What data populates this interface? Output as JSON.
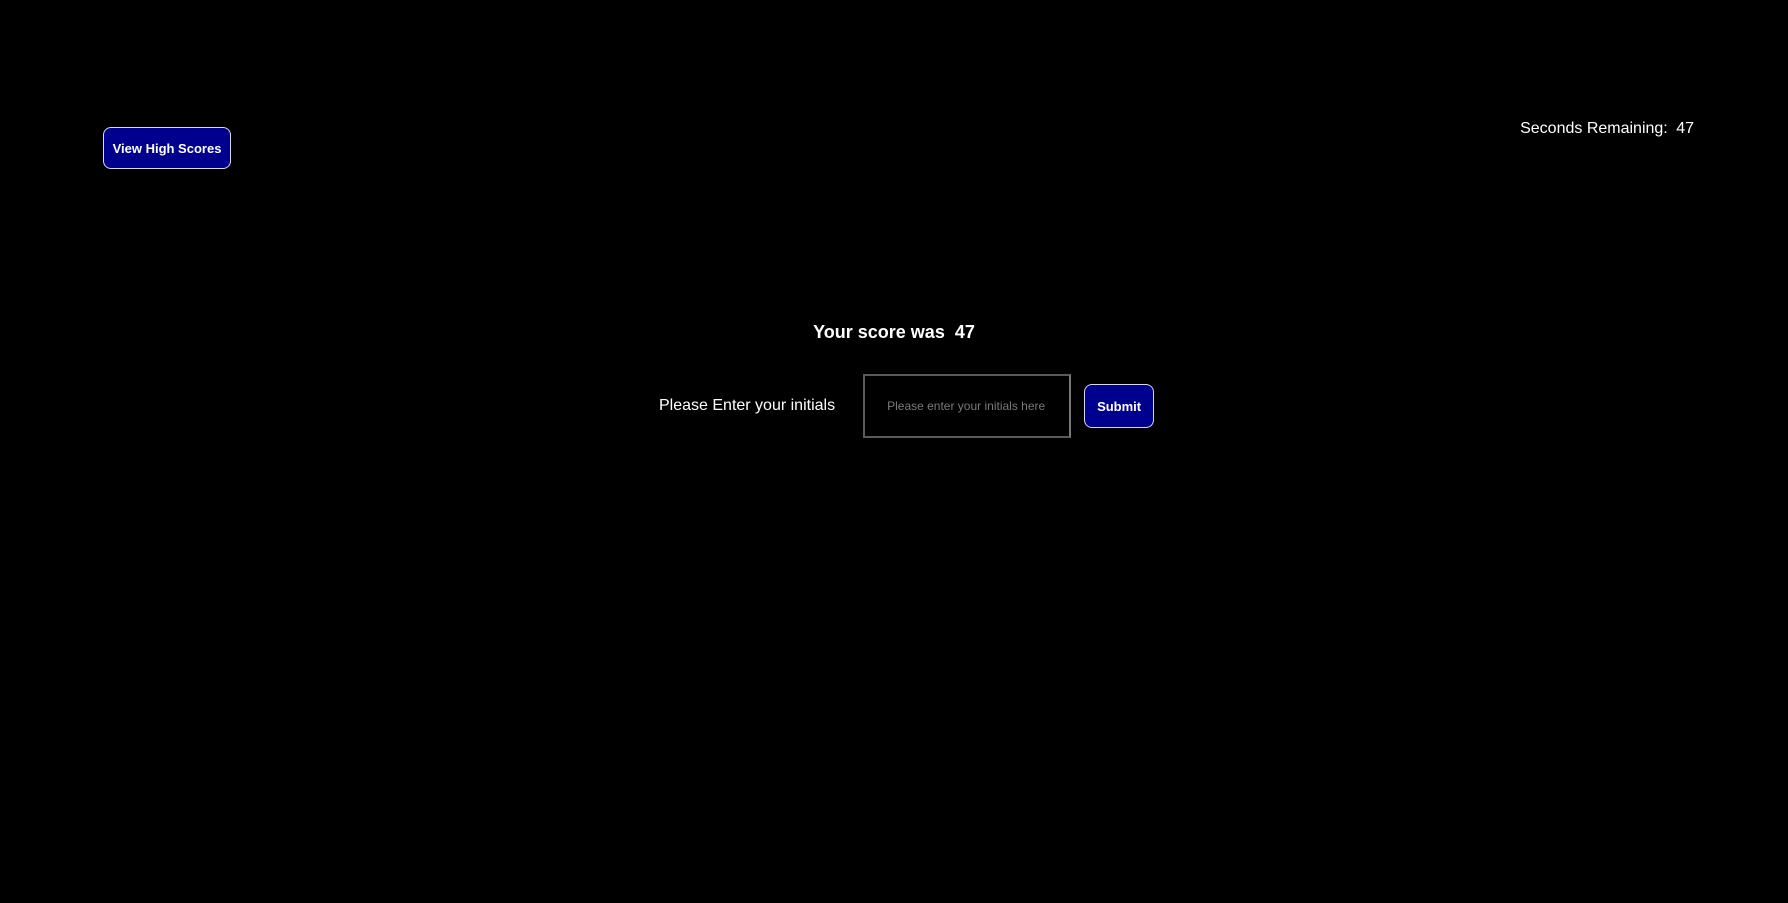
{
  "header": {
    "high_scores_label": "View High Scores",
    "timer_label": "Seconds Remaining:",
    "timer_value": "47"
  },
  "result": {
    "score_label": "Your score was",
    "score_value": "47"
  },
  "form": {
    "initials_label": "Please Enter your initials",
    "initials_placeholder": "Please enter your initials here",
    "initials_value": "",
    "submit_label": "Submit"
  },
  "colors": {
    "background": "#000000",
    "button_bg": "#00008f",
    "button_border": "#d8d8f0",
    "text": "#ffffff"
  }
}
